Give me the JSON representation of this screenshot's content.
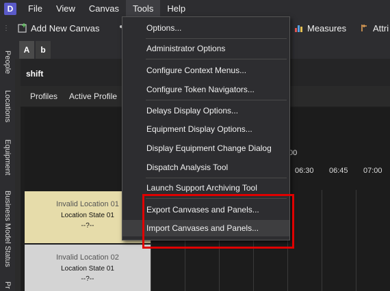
{
  "app_icon_letter": "D",
  "menubar": {
    "items": [
      "File",
      "View",
      "Canvas",
      "Tools",
      "Help"
    ]
  },
  "toolbar": {
    "add_canvas": "Add New Canvas",
    "measures": "Measures",
    "attributes": "Attri"
  },
  "left_tabs": [
    "People",
    "Locations",
    "Equipment",
    "Business Model Status",
    "Pr"
  ],
  "doc_tabs": [
    "A",
    "b"
  ],
  "panel": {
    "title": "shift",
    "subtabs": [
      "Profiles",
      "Active Profile"
    ]
  },
  "timeline": {
    "hour_label": "00",
    "slots": [
      "06:30",
      "06:45",
      "07:00"
    ]
  },
  "locations": [
    {
      "name": "Invalid Location 01",
      "state": "Location State 01",
      "value": "--?--",
      "color": "#e6dcaa"
    },
    {
      "name": "Invalid Location 02",
      "state": "Location State 01",
      "value": "--?--",
      "color": "#d4d4d4"
    }
  ],
  "tools_menu": {
    "items": [
      "Options...",
      "Administrator Options",
      "Configure Context Menus...",
      "Configure Token Navigators...",
      "Delays Display Options...",
      "Equipment Display Options...",
      "Display Equipment Change Dialog",
      "Dispatch Analysis Tool",
      "Launch Support Archiving Tool",
      "Export Canvases and Panels...",
      "Import Canvases and Panels..."
    ]
  },
  "colors": {
    "highlight": "#e00000",
    "accent_icon": "#5a5ac8"
  }
}
